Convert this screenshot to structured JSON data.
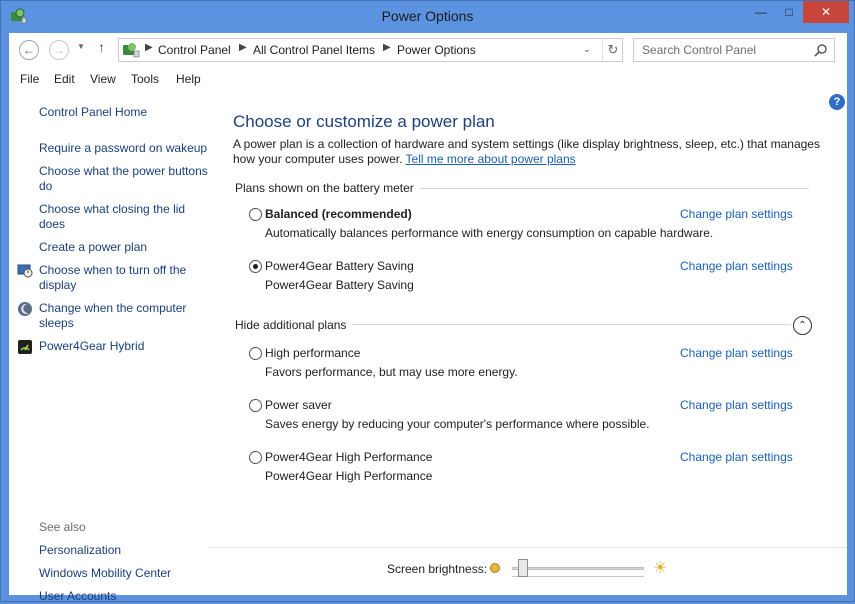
{
  "window": {
    "title": "Power Options"
  },
  "addressbar": {
    "crumbs": [
      "Control Panel",
      "All Control Panel Items",
      "Power Options"
    ],
    "search_placeholder": "Search Control Panel"
  },
  "menu": [
    "File",
    "Edit",
    "View",
    "Tools",
    "Help"
  ],
  "sidebar": {
    "home": "Control Panel Home",
    "links": [
      "Require a password on wakeup",
      "Choose what the power buttons do",
      "Choose what closing the lid does",
      "Create a power plan",
      "Choose when to turn off the display",
      "Change when the computer sleeps",
      "Power4Gear Hybrid"
    ],
    "see_also_label": "See also",
    "see_also": [
      "Personalization",
      "Windows Mobility Center",
      "User Accounts"
    ]
  },
  "main": {
    "title": "Choose or customize a power plan",
    "intro": "A power plan is a collection of hardware and system settings (like display brightness, sleep, etc.) that manages how your computer uses power. ",
    "intro_link": "Tell me more about power plans",
    "battery_section": "Plans shown on the battery meter",
    "hidden_section": "Hide additional plans",
    "change_link": "Change plan settings",
    "plans_shown": [
      {
        "name": "Balanced (recommended)",
        "desc": "Automatically balances performance with energy consumption on capable hardware.",
        "selected": false
      },
      {
        "name": "Power4Gear Battery Saving",
        "desc": "Power4Gear Battery Saving",
        "selected": true
      }
    ],
    "plans_hidden": [
      {
        "name": "High performance",
        "desc": "Favors performance, but may use more energy.",
        "selected": false
      },
      {
        "name": "Power saver",
        "desc": "Saves energy by reducing your computer's performance where possible.",
        "selected": false
      },
      {
        "name": "Power4Gear High Performance",
        "desc": "Power4Gear High Performance",
        "selected": false
      }
    ]
  },
  "brightness": {
    "label": "Screen brightness:",
    "level": 0.05
  },
  "colors": {
    "title_bar": "#5b93e0",
    "close_button": "#c7453a",
    "link": "#1a5fb4",
    "heading": "#1e3f7a"
  },
  "icons": [
    "power-options-icon",
    "back-icon",
    "forward-icon",
    "up-icon",
    "refresh-icon",
    "search-icon",
    "help-icon",
    "display-off-icon",
    "sleep-icon",
    "power4gear-icon",
    "collapse-icon",
    "brightness-dim-icon",
    "brightness-bright-icon"
  ]
}
